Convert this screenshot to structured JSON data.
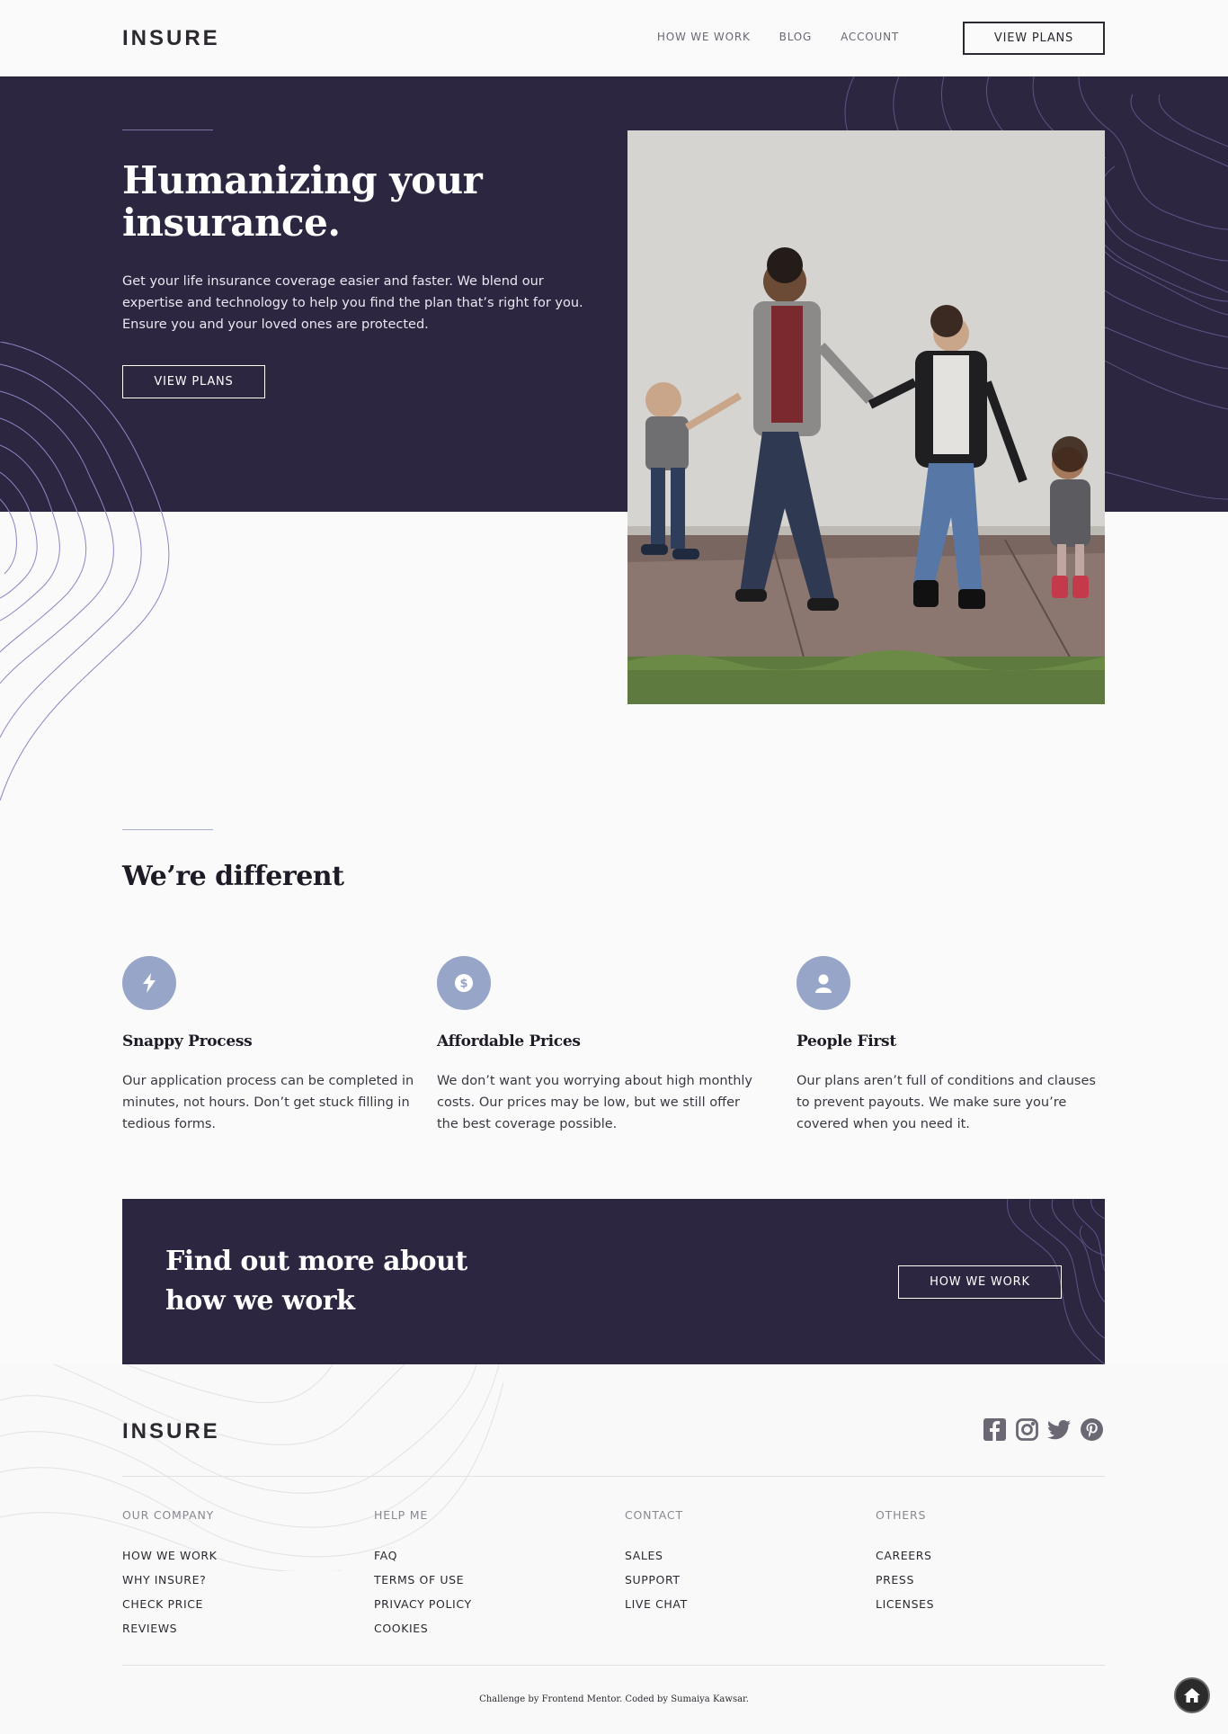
{
  "header": {
    "logo": "INSURE",
    "nav": [
      "HOW WE WORK",
      "BLOG",
      "ACCOUNT"
    ],
    "cta_label": "VIEW PLANS"
  },
  "hero": {
    "title": "Humanizing your insurance.",
    "text": "Get your life insurance coverage easier and faster. We blend our expertise and technology to help you find the plan that’s right for you. Ensure you and your loved ones are protected.",
    "button_label": "VIEW PLANS"
  },
  "different": {
    "title": "We’re different",
    "features": [
      {
        "icon": "bolt-icon",
        "title": "Snappy Process",
        "text": "Our application process can be completed in minutes, not hours. Don’t get stuck filling in tedious forms."
      },
      {
        "icon": "dollar-icon",
        "title": "Affordable Prices",
        "text": "We don’t want you worrying about high monthly costs. Our prices may be low, but we still offer the best coverage possible."
      },
      {
        "icon": "person-icon",
        "title": "People First",
        "text": "Our plans aren’t full of conditions and clauses to prevent payouts. We make sure you’re covered when you need it."
      }
    ]
  },
  "cta": {
    "title": "Find out more about how we work",
    "button_label": "HOW WE WORK"
  },
  "footer": {
    "logo": "INSURE",
    "socials": [
      "facebook-icon",
      "instagram-icon",
      "twitter-icon",
      "pinterest-icon"
    ],
    "columns": [
      {
        "heading": "OUR COMPANY",
        "links": [
          "HOW WE WORK",
          "WHY INSURE?",
          "CHECK PRICE",
          "REVIEWS"
        ]
      },
      {
        "heading": "HELP ME",
        "links": [
          "FAQ",
          "TERMS OF USE",
          "PRIVACY POLICY",
          "COOKIES"
        ]
      },
      {
        "heading": "CONTACT",
        "links": [
          "SALES",
          "SUPPORT",
          "LIVE CHAT"
        ]
      },
      {
        "heading": "OTHERS",
        "links": [
          "CAREERS",
          "PRESS",
          "LICENSES"
        ]
      }
    ],
    "attribution": "Challenge by Frontend Mentor. Coded by Sumaiya Kawsar."
  },
  "colors": {
    "dark_violet": "#2c2640",
    "grayish_blue": "#97a5c8",
    "very_light_gray": "#fafafa"
  }
}
